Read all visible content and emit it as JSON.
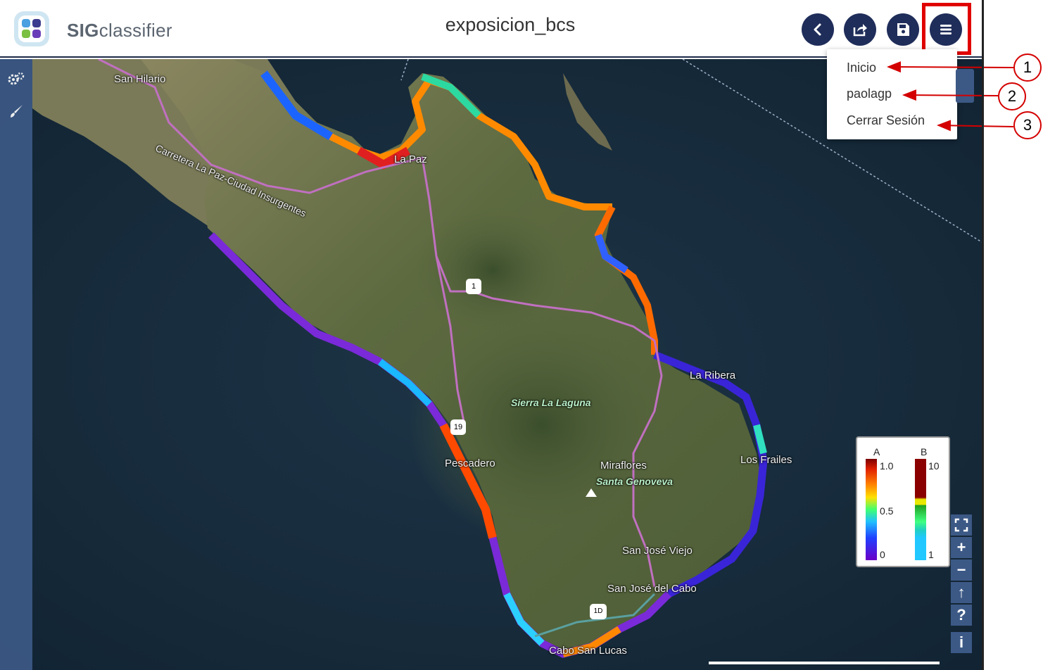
{
  "header": {
    "app_name_bold": "SIG",
    "app_name_rest": "classifier",
    "doc_title": "exposicion_bcs",
    "buttons": [
      {
        "name": "back-button",
        "icon": "chevron-left-icon"
      },
      {
        "name": "share-button",
        "icon": "share-icon"
      },
      {
        "name": "save-button",
        "icon": "save-icon"
      },
      {
        "name": "menu-button",
        "icon": "hamburger-icon"
      }
    ]
  },
  "menu": {
    "items": [
      "Inicio",
      "paolagp",
      "Cerrar Sesión"
    ]
  },
  "callouts": [
    "1",
    "2",
    "3"
  ],
  "map": {
    "labels": {
      "san_hilario": "San Hilario",
      "carretera": "Carretera La Paz-Ciudad Insurgentes",
      "la_paz": "La Paz",
      "sierra": "Sierra La Laguna",
      "pescadero": "Pescadero",
      "miraflores": "Miraflores",
      "santa_genoveva": "Santa Genoveva",
      "los_frailes": "Los Frailes",
      "san_jose_viejo": "San José Viejo",
      "san_jose_cabo": "San José del Cabo",
      "cabo": "Cabo San Lucas",
      "la_ribera": "La Ribera",
      "hw1": "1",
      "hw19": "19",
      "hw1d": "1D"
    }
  },
  "legend": {
    "a_title": "A",
    "a_max": "1.0",
    "a_mid": "0.5",
    "a_min": "0",
    "b_title": "B",
    "b_max": "10",
    "b_min": "1"
  },
  "zoom_controls": {
    "fullscreen_icon": "fullscreen-icon",
    "zoom_in": "+",
    "zoom_out": "−",
    "north": "↑",
    "help": "?",
    "info": "i"
  },
  "colors": {
    "header_button": "#1f2d5a",
    "toolbar": "#3c5986",
    "highlight": "#e00000"
  }
}
